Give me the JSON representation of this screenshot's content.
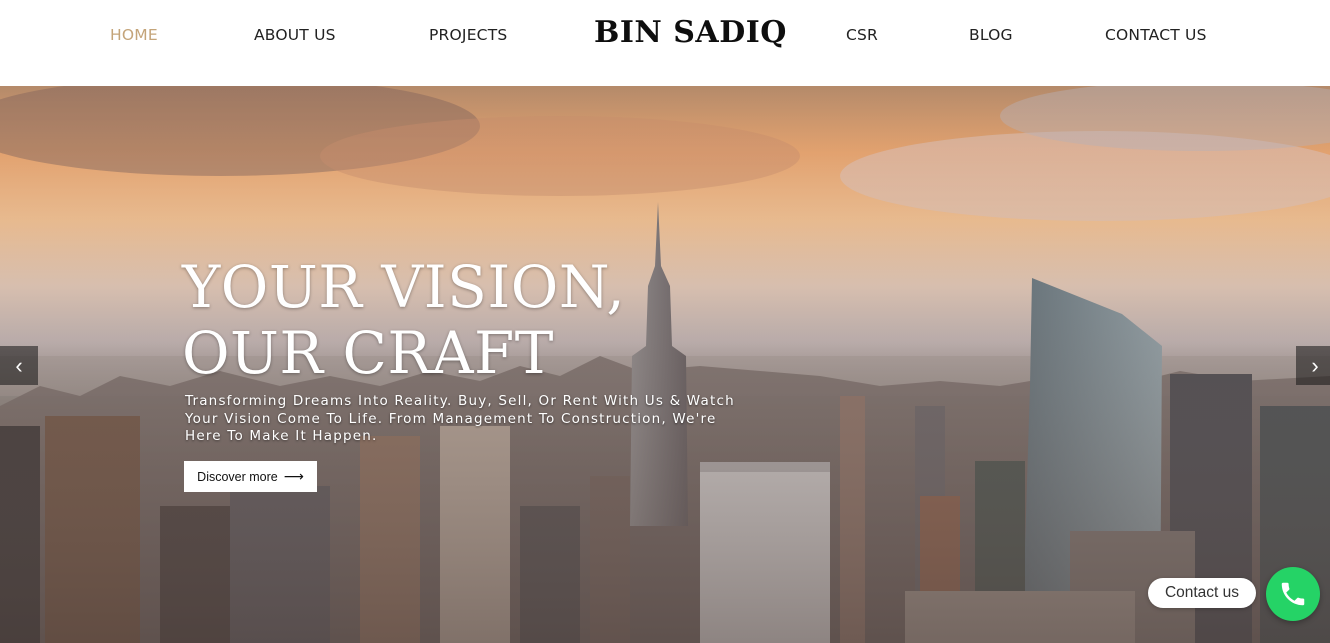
{
  "header": {
    "brand": "BIN SADIQ",
    "nav": [
      {
        "label": "HOME",
        "active": true
      },
      {
        "label": "ABOUT US"
      },
      {
        "label": "PROJECTS"
      },
      {
        "label": "CSR"
      },
      {
        "label": "BLOG"
      },
      {
        "label": "CONTACT US"
      }
    ],
    "active_color": "#c4a479"
  },
  "hero": {
    "title_line1": "YOUR VISION,",
    "title_line2": "OUR CRAFT",
    "subtitle": "Transforming Dreams Into Reality. Buy, Sell, Or Rent With Us & Watch Your Vision Come To Life. From Management To Construction, We're Here To Make It Happen.",
    "cta_label": "Discover more",
    "cta_icon": "arrow-right-icon",
    "prev_icon": "chevron-left-icon",
    "next_icon": "chevron-right-icon"
  },
  "floating": {
    "contact_label": "Contact us",
    "contact_icon": "phone-icon",
    "contact_color": "#25d366"
  }
}
